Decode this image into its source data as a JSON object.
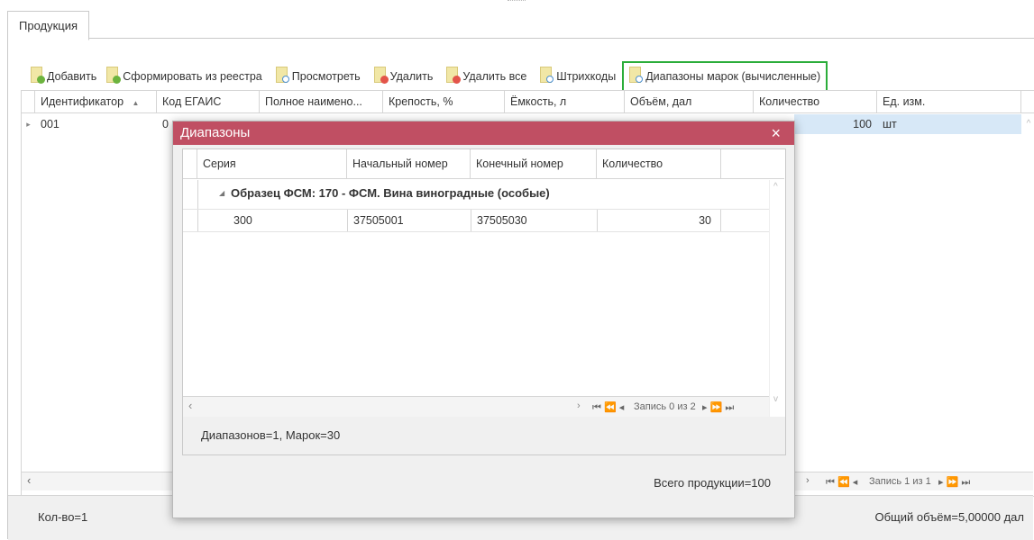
{
  "tab": {
    "label": "Продукция"
  },
  "toolbar": {
    "buttons": [
      {
        "label": "Добавить",
        "icon": "add-icon"
      },
      {
        "label": "Сформировать из реестра",
        "icon": "add-icon"
      },
      {
        "label": "Просмотреть",
        "icon": "view-icon"
      },
      {
        "label": "Удалить",
        "icon": "delete-icon"
      },
      {
        "label": "Удалить все",
        "icon": "delete-icon"
      },
      {
        "label": "Штрихкоды",
        "icon": "view-icon"
      },
      {
        "label": "Диапазоны марок (вычисленные)",
        "icon": "view-icon"
      }
    ]
  },
  "grid": {
    "columns": [
      "Идентификатор",
      "Код ЕГАИС",
      "Полное наимено...",
      "Крепость, %",
      "Ёмкость, л",
      "Объём, дал",
      "Количество",
      "Ед. изм."
    ],
    "row": {
      "id": "001",
      "egais_prefix": "0",
      "quantity": "100",
      "unit": "шт"
    },
    "nav_text": "Запись 1 из 1",
    "footer_left": "Кол-во=1",
    "footer_right": "Общий объём=5,00000 дал"
  },
  "modal": {
    "title": "Диапазоны",
    "close": "×",
    "columns": [
      "Серия",
      "Начальный номер",
      "Конечный номер",
      "Количество"
    ],
    "group_label": "Образец ФСМ: 170 - ФСМ. Вина виноградные (особые)",
    "row": {
      "series": "300",
      "start": "37505001",
      "end": "37505030",
      "count": "30"
    },
    "nav_text": "Запись 0 из 2",
    "summary": "Диапазонов=1, Марок=30",
    "total": "Всего продукции=100"
  }
}
